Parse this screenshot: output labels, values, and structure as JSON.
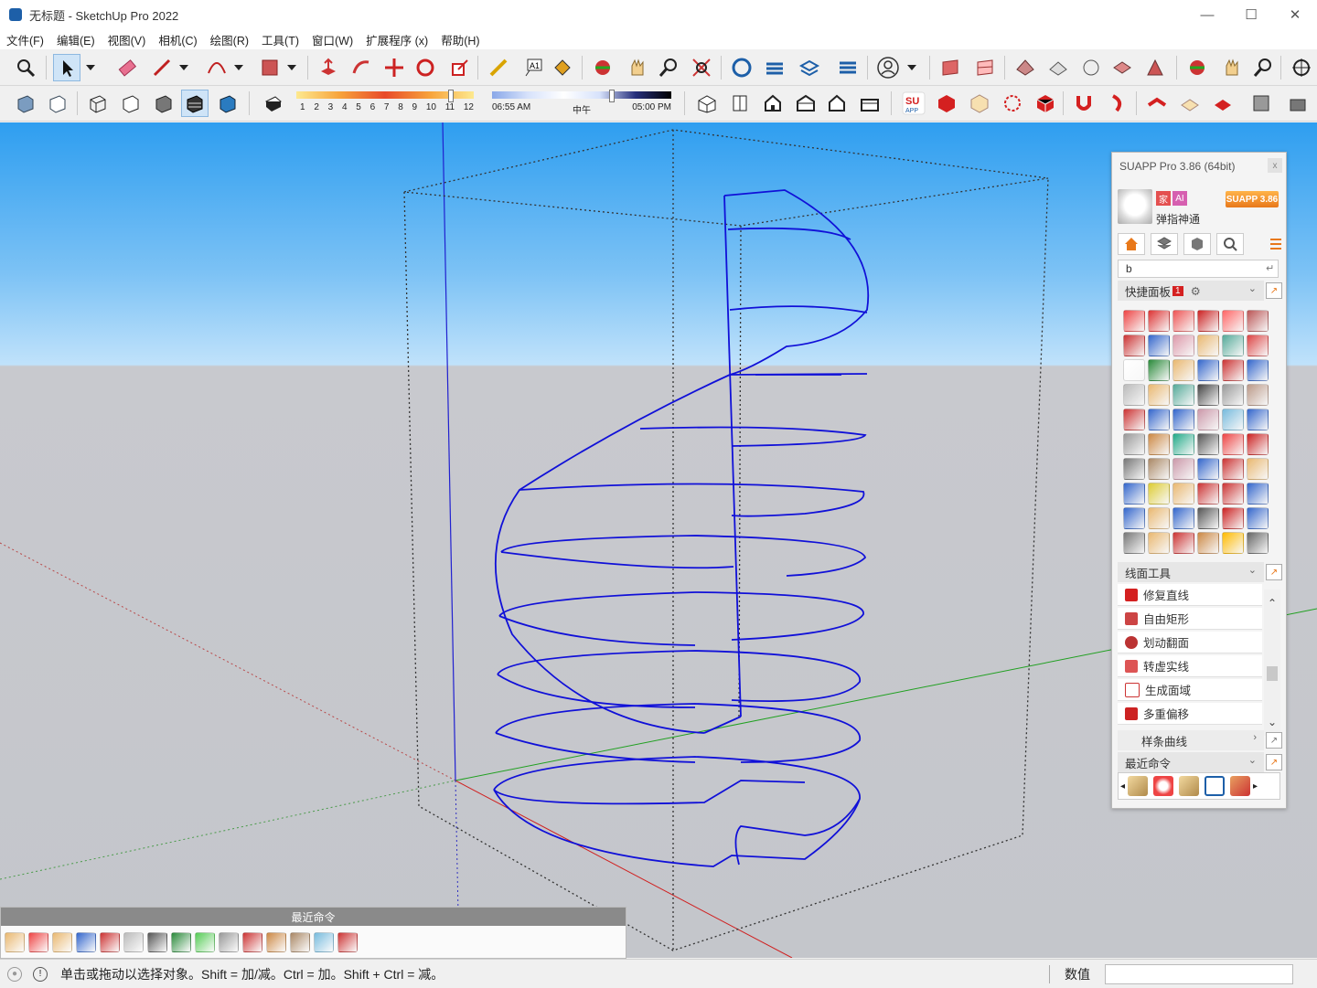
{
  "window": {
    "title": "无标题 - SketchUp Pro 2022",
    "minimize": "—",
    "maximize": "☐",
    "close": "✕"
  },
  "menu": [
    "文件(F)",
    "编辑(E)",
    "视图(V)",
    "相机(C)",
    "绘图(R)",
    "工具(T)",
    "窗口(W)",
    "扩展程序 (x)",
    "帮助(H)"
  ],
  "shadow": {
    "month_ticks": [
      "1",
      "2",
      "3",
      "4",
      "5",
      "6",
      "7",
      "8",
      "9",
      "10",
      "11",
      "12"
    ],
    "time_start": "06:55 AM",
    "time_mid": "中午",
    "time_end": "05:00 PM"
  },
  "suapp_panel": {
    "title": "SUAPP Pro 3.86 (64bit)",
    "close": "x",
    "badge_red": "家",
    "badge_ai": "AI",
    "username": "弹指神通",
    "version_badge": "SUAPP 3.86",
    "search_value": "b",
    "quick_panel": "快捷面板",
    "quick_panel_num": "1",
    "line_tools": "线面工具",
    "list_items": [
      "修复直线",
      "自由矩形",
      "划动翻面",
      "转虚实线",
      "生成面域",
      "多重偏移"
    ],
    "spline_item": "样条曲线",
    "recent_section": "最近命令"
  },
  "bottom_recent": {
    "title": "最近命令"
  },
  "status": {
    "message": "单击或拖动以选择对象。Shift = 加/减。Ctrl = 加。Shift + Ctrl = 减。",
    "measure_label": "数值",
    "measure_value": ""
  },
  "colors": {
    "sky_top": "#2e9ef0",
    "ground": "#c4c6cb",
    "geometry": "#1010d8",
    "accent_orange": "#e8781a",
    "axis_red": "#d02020",
    "axis_green": "#20a020"
  }
}
